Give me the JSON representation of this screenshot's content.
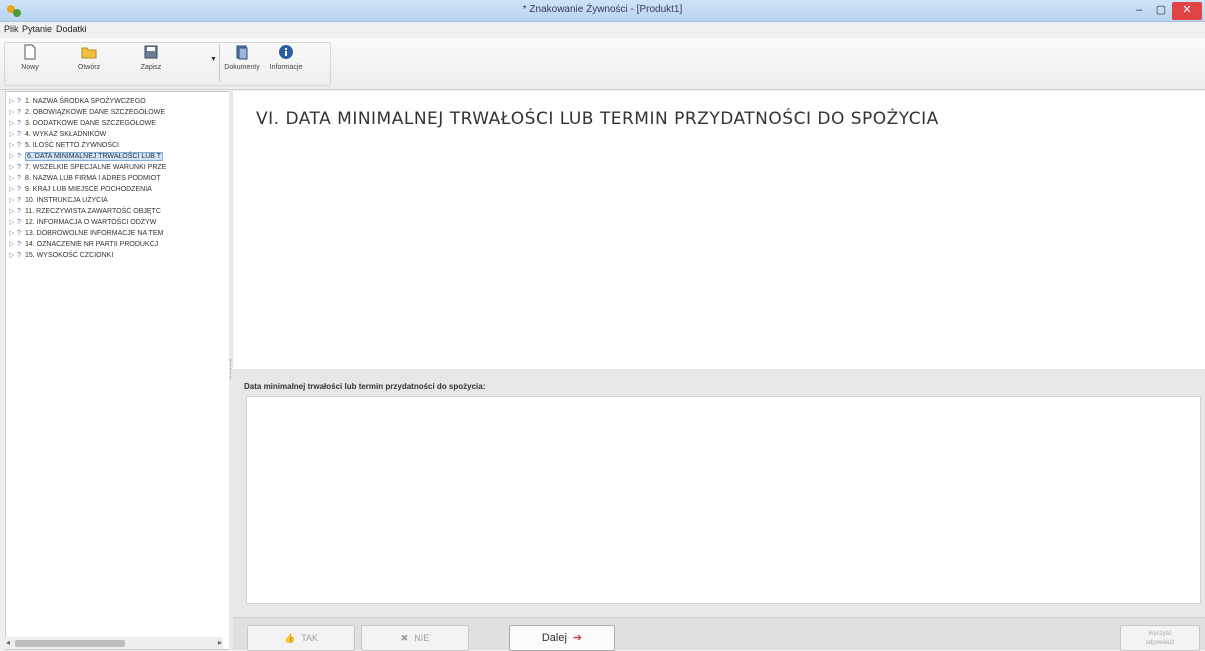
{
  "window": {
    "title": "* Znakowanie Żywności - [Produkt1]",
    "minimize": "–",
    "maximize": "▢",
    "close": "✕"
  },
  "menu": [
    "Plik",
    "Pytanie",
    "Dodatki"
  ],
  "toolbar": {
    "new_label": "Nowy",
    "open_label": "Otwórz",
    "save_label": "Zapisz",
    "documents_label": "Dokumenty",
    "info_label": "Informacje"
  },
  "tree": {
    "items": [
      {
        "label": "1. NAZWA ŚRODKA SPOŻYWCZEGO"
      },
      {
        "label": "2. OBOWIĄZKOWE DANE SZCZEGÓŁOWE"
      },
      {
        "label": "3. DODATKOWE DANE SZCZEGÓŁOWE"
      },
      {
        "label": "4. WYKAZ SKŁADNIKÓW"
      },
      {
        "label": "5. ILOŚĆ NETTO ŻYWNOŚCI"
      },
      {
        "label": "6. DATA MINIMALNEJ TRWAŁOŚCI LUB T"
      },
      {
        "label": "7. WSZELKIE SPECJALNE WARUNKI PRZE"
      },
      {
        "label": "8. NAZWA LUB FIRMA I ADRES PODMIOT"
      },
      {
        "label": "9. KRAJ LUB MIEJSCE POCHODZENIA"
      },
      {
        "label": "10. INSTRUKCJA UŻYCIA"
      },
      {
        "label": "11. RZECZYWISTA ZAWARTOŚĆ OBJĘTC"
      },
      {
        "label": "12. INFORMACJA O WARTOŚCI ODŻYW"
      },
      {
        "label": "13. DOBROWOLNE INFORMACJE NA TEM"
      },
      {
        "label": "14. OZNACZENIE NR PARTII PRODUKCJ"
      },
      {
        "label": "15. WYSOKOŚĆ CZCIONKI"
      }
    ],
    "selected_index": 5
  },
  "section": {
    "heading": "VI. DATA MINIMALNEJ TRWAŁOŚCI LUB TERMIN PRZYDATNOŚCI DO SPOŻYCIA",
    "field_label": "Data minimalnej trwałości lub termin przydatności do spożycia:",
    "field_value": ""
  },
  "buttons": {
    "tak": "TAK",
    "nie": "NIE",
    "dalej": "Dalej",
    "right_line1": "Wyczyść",
    "right_line2": "odpowiedź"
  },
  "colors": {
    "titlebar": "#b9d4ef",
    "close_button": "#e04343",
    "selection": "#cfe4fa"
  }
}
